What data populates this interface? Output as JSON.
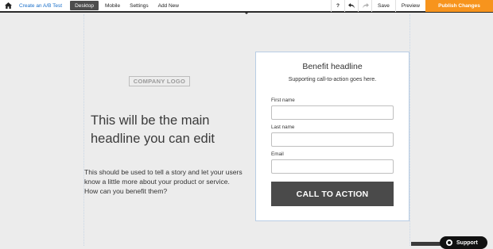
{
  "toolbar": {
    "home_icon": "home-icon",
    "ab_test_label": "Create an A/B Test",
    "view_tabs": [
      {
        "label": "Desktop",
        "active": true
      },
      {
        "label": "Mobile",
        "active": false
      }
    ],
    "settings_label": "Settings",
    "add_new_label": "Add New",
    "help_label": "?",
    "undo_icon": "undo-icon",
    "redo_icon": "redo-icon",
    "save_label": "Save",
    "preview_label": "Preview",
    "publish_label": "Publish Changes",
    "publish_color": "#f7941d"
  },
  "page": {
    "logo_text": "COMPANY LOGO",
    "headline": "This will be the main headline you can edit",
    "body": "This should be used to tell a story and let your users know a little more about your product or service. How can you benefit them?"
  },
  "form": {
    "title": "Benefit headline",
    "subtitle": "Supporting call-to-action goes here.",
    "fields": [
      {
        "label": "First name",
        "value": ""
      },
      {
        "label": "Last name",
        "value": ""
      },
      {
        "label": "Email",
        "value": ""
      }
    ],
    "cta_label": "CALL TO ACTION"
  },
  "support": {
    "label": "Support"
  }
}
